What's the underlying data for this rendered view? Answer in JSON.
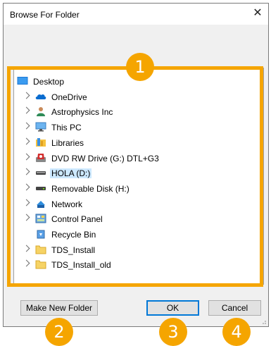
{
  "dialog": {
    "title": "Browse For Folder",
    "close_symbol": "✕"
  },
  "tree": {
    "items": [
      {
        "label": "Desktop",
        "icon": "desktop-icon",
        "expandable": false,
        "indent": 0
      },
      {
        "label": "OneDrive",
        "icon": "cloud-icon",
        "expandable": true,
        "indent": 1
      },
      {
        "label": "Astrophysics Inc",
        "icon": "user-icon",
        "expandable": true,
        "indent": 1
      },
      {
        "label": "This PC",
        "icon": "monitor-icon",
        "expandable": true,
        "indent": 1
      },
      {
        "label": "Libraries",
        "icon": "libraries-icon",
        "expandable": true,
        "indent": 1
      },
      {
        "label": "DVD RW Drive (G:) DTL+G3",
        "icon": "dvd-drive-icon",
        "expandable": true,
        "indent": 1
      },
      {
        "label": "HOLA (D:)",
        "icon": "drive-icon",
        "expandable": true,
        "indent": 1,
        "selected": true
      },
      {
        "label": "Removable Disk (H:)",
        "icon": "removable-drive-icon",
        "expandable": true,
        "indent": 1
      },
      {
        "label": "Network",
        "icon": "network-icon",
        "expandable": true,
        "indent": 1
      },
      {
        "label": "Control Panel",
        "icon": "control-panel-icon",
        "expandable": true,
        "indent": 1
      },
      {
        "label": "Recycle Bin",
        "icon": "recycle-bin-icon",
        "expandable": false,
        "indent": 1
      },
      {
        "label": "TDS_Install",
        "icon": "folder-icon",
        "expandable": true,
        "indent": 1
      },
      {
        "label": "TDS_Install_old",
        "icon": "folder-icon",
        "expandable": true,
        "indent": 1
      }
    ]
  },
  "buttons": {
    "make_new_folder": "Make New Folder",
    "ok": "OK",
    "cancel": "Cancel"
  },
  "callouts": [
    "1",
    "2",
    "3",
    "4"
  ],
  "colors": {
    "highlight": "#f5a500",
    "selection": "#cce8ff",
    "focus": "#0078d7"
  }
}
